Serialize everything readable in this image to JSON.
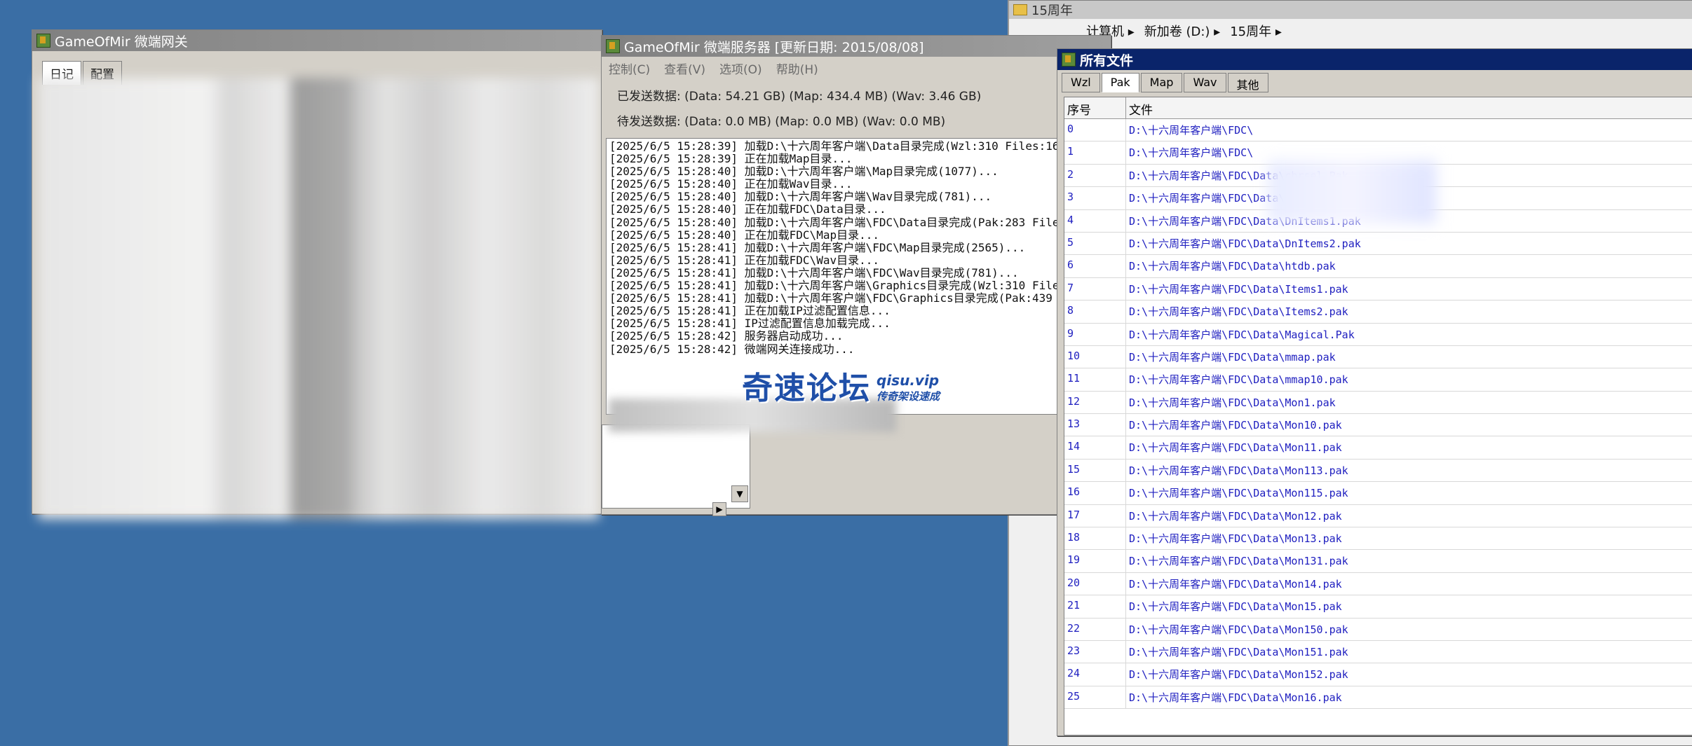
{
  "gateway": {
    "title": "GameOfMir 微端网关",
    "tabs": [
      "日记",
      "配置"
    ]
  },
  "server": {
    "title": "GameOfMir 微端服务器 [更新日期: 2015/08/08]",
    "menu": [
      "控制(C)",
      "查看(V)",
      "选项(O)",
      "帮助(H)"
    ],
    "sent": "已发送数据: (Data: 54.21 GB) (Map: 434.4 MB) (Wav: 3.46 GB)",
    "pending": "待发送数据: (Data: 0.0 MB) (Map: 0.0 MB) (Wav: 0.0 MB)",
    "log": [
      "[2025/6/5 15:28:39] 加载D:\\十六周年客户端\\Data目录完成(Wzl:310 Files:16",
      "[2025/6/5 15:28:39] 正在加载Map目录...",
      "[2025/6/5 15:28:40] 加载D:\\十六周年客户端\\Map目录完成(1077)...",
      "[2025/6/5 15:28:40] 正在加载Wav目录...",
      "[2025/6/5 15:28:40] 加载D:\\十六周年客户端\\Wav目录完成(781)...",
      "[2025/6/5 15:28:40] 正在加载FDC\\Data目录...",
      "[2025/6/5 15:28:40] 加载D:\\十六周年客户端\\FDC\\Data目录完成(Pak:283 File",
      "[2025/6/5 15:28:40] 正在加载FDC\\Map目录...",
      "[2025/6/5 15:28:41] 加载D:\\十六周年客户端\\FDC\\Map目录完成(2565)...",
      "[2025/6/5 15:28:41] 正在加载FDC\\Wav目录...",
      "[2025/6/5 15:28:41] 加载D:\\十六周年客户端\\FDC\\Wav目录完成(781)...",
      "[2025/6/5 15:28:41] 加载D:\\十六周年客户端\\Graphics目录完成(Wzl:310 File",
      "[2025/6/5 15:28:41] 加载D:\\十六周年客户端\\FDC\\Graphics目录完成(Pak:439",
      "[2025/6/5 15:28:41] 正在加载IP过滤配置信息...",
      "[2025/6/5 15:28:41] IP过滤配置信息加载完成...",
      "[2025/6/5 15:28:42] 服务器启动成功...",
      "[2025/6/5 15:28:42] 微端网关连接成功..."
    ]
  },
  "watermark": {
    "main": "奇速论坛",
    "url": "qisu.vip",
    "sub": "传奇架设速成"
  },
  "explorer": {
    "title": "15周年",
    "breadcrumb": [
      "计算机 ▸",
      "新加卷 (D:) ▸",
      "15周年 ▸"
    ]
  },
  "files": {
    "title": "所有文件",
    "tabs": [
      "Wzl",
      "Pak",
      "Map",
      "Wav",
      "其他"
    ],
    "selected_tab": "Pak",
    "headers": [
      "序号",
      "文件"
    ],
    "rows": [
      [
        "0",
        "D:\\十六周年客户端\\FDC\\"
      ],
      [
        "1",
        "D:\\十六周年客户端\\FDC\\"
      ],
      [
        "2",
        "D:\\十六周年客户端\\FDC\\Data\\chrsel.Pak"
      ],
      [
        "3",
        "D:\\十六周年客户端\\FDC\\Data\\cqBtn.Pak"
      ],
      [
        "4",
        "D:\\十六周年客户端\\FDC\\Data\\DnItems1.pak"
      ],
      [
        "5",
        "D:\\十六周年客户端\\FDC\\Data\\DnItems2.pak"
      ],
      [
        "6",
        "D:\\十六周年客户端\\FDC\\Data\\htdb.pak"
      ],
      [
        "7",
        "D:\\十六周年客户端\\FDC\\Data\\Items1.pak"
      ],
      [
        "8",
        "D:\\十六周年客户端\\FDC\\Data\\Items2.pak"
      ],
      [
        "9",
        "D:\\十六周年客户端\\FDC\\Data\\Magical.Pak"
      ],
      [
        "10",
        "D:\\十六周年客户端\\FDC\\Data\\mmap.pak"
      ],
      [
        "11",
        "D:\\十六周年客户端\\FDC\\Data\\mmap10.pak"
      ],
      [
        "12",
        "D:\\十六周年客户端\\FDC\\Data\\Mon1.pak"
      ],
      [
        "13",
        "D:\\十六周年客户端\\FDC\\Data\\Mon10.pak"
      ],
      [
        "14",
        "D:\\十六周年客户端\\FDC\\Data\\Mon11.pak"
      ],
      [
        "15",
        "D:\\十六周年客户端\\FDC\\Data\\Mon113.pak"
      ],
      [
        "16",
        "D:\\十六周年客户端\\FDC\\Data\\Mon115.pak"
      ],
      [
        "17",
        "D:\\十六周年客户端\\FDC\\Data\\Mon12.pak"
      ],
      [
        "18",
        "D:\\十六周年客户端\\FDC\\Data\\Mon13.pak"
      ],
      [
        "19",
        "D:\\十六周年客户端\\FDC\\Data\\Mon131.pak"
      ],
      [
        "20",
        "D:\\十六周年客户端\\FDC\\Data\\Mon14.pak"
      ],
      [
        "21",
        "D:\\十六周年客户端\\FDC\\Data\\Mon15.pak"
      ],
      [
        "22",
        "D:\\十六周年客户端\\FDC\\Data\\Mon150.pak"
      ],
      [
        "23",
        "D:\\十六周年客户端\\FDC\\Data\\Mon151.pak"
      ],
      [
        "24",
        "D:\\十六周年客户端\\FDC\\Data\\Mon152.pak"
      ],
      [
        "25",
        "D:\\十六周年客户端\\FDC\\Data\\Mon16.pak"
      ]
    ]
  },
  "colors": {
    "desktop": "#3a6ea5",
    "link_text": "#2020c0",
    "watermark": "#1f4fa8"
  }
}
